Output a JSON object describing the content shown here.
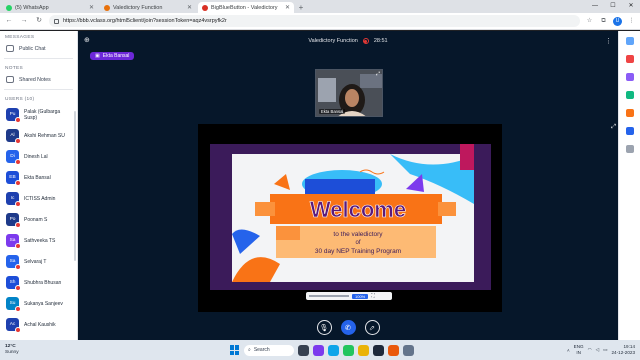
{
  "browser": {
    "tabs": [
      {
        "label": "(5) WhatsApp",
        "favicon_color": "#25d366",
        "active": false
      },
      {
        "label": "Valedictory Function",
        "favicon_color": "#e8710a",
        "active": false
      },
      {
        "label": "BigBlueButton - Valedictory",
        "favicon_color": "#d93025",
        "active": true
      }
    ],
    "new_tab": "+",
    "url": "https://bbb.vclass.org/html5client/join?sessionToken=aqz4vsrpyfk2r",
    "profile_initial": "U"
  },
  "sidebar": {
    "messages_title": "MESSAGES",
    "public_chat": "Public Chat",
    "notes_title": "NOTES",
    "shared_notes": "Shared Notes",
    "users_title": "USERS (10)",
    "users": [
      {
        "initials": "Pu",
        "name": "Palak (Gulbarga Susp)",
        "color": "#1e40af"
      },
      {
        "initials": "Al",
        "name": "Akshi Rehman SU",
        "color": "#1e3a8a"
      },
      {
        "initials": "Di",
        "name": "Dinesh Lal",
        "color": "#2563eb"
      },
      {
        "initials": "EB",
        "name": "Ekta Bansal",
        "color": "#1d4ed8"
      },
      {
        "initials": "Ic",
        "name": "ICTISS Admin",
        "color": "#1e40af"
      },
      {
        "initials": "Po",
        "name": "Poonam S",
        "color": "#1e3a8a"
      },
      {
        "initials": "Sa",
        "name": "Sathveeka TS",
        "color": "#7c3aed"
      },
      {
        "initials": "Sa",
        "name": "Selvaraj T",
        "color": "#2563eb"
      },
      {
        "initials": "Sh",
        "name": "Shubhra Bhusan",
        "color": "#1d4ed8"
      },
      {
        "initials": "Su",
        "name": "Sukanya Sanjeev",
        "color": "#0284c7"
      },
      {
        "initials": "Ac",
        "name": "Achal Kaushik",
        "color": "#1e40af"
      }
    ]
  },
  "meeting": {
    "title": "Valedictory Function",
    "timer": "28:51",
    "presenter": "Ekta Bansal",
    "webcam_name": "Ekta Bansal"
  },
  "slide": {
    "heading": "Welcome",
    "line1": "to the valedictory",
    "line2": "of",
    "line3": "30 day NEP Training Program",
    "zoom_value": "100%"
  },
  "controls": {
    "mute_icon": "microphone-icon",
    "leave_icon": "phone-icon",
    "screen_icon": "screen-share-icon"
  },
  "taskbar": {
    "temp": "12°C",
    "weather": "Sunny",
    "search_placeholder": "Search",
    "lang1": "ENG",
    "lang2": "IN",
    "time": "19:14",
    "date": "24-12-2023"
  }
}
